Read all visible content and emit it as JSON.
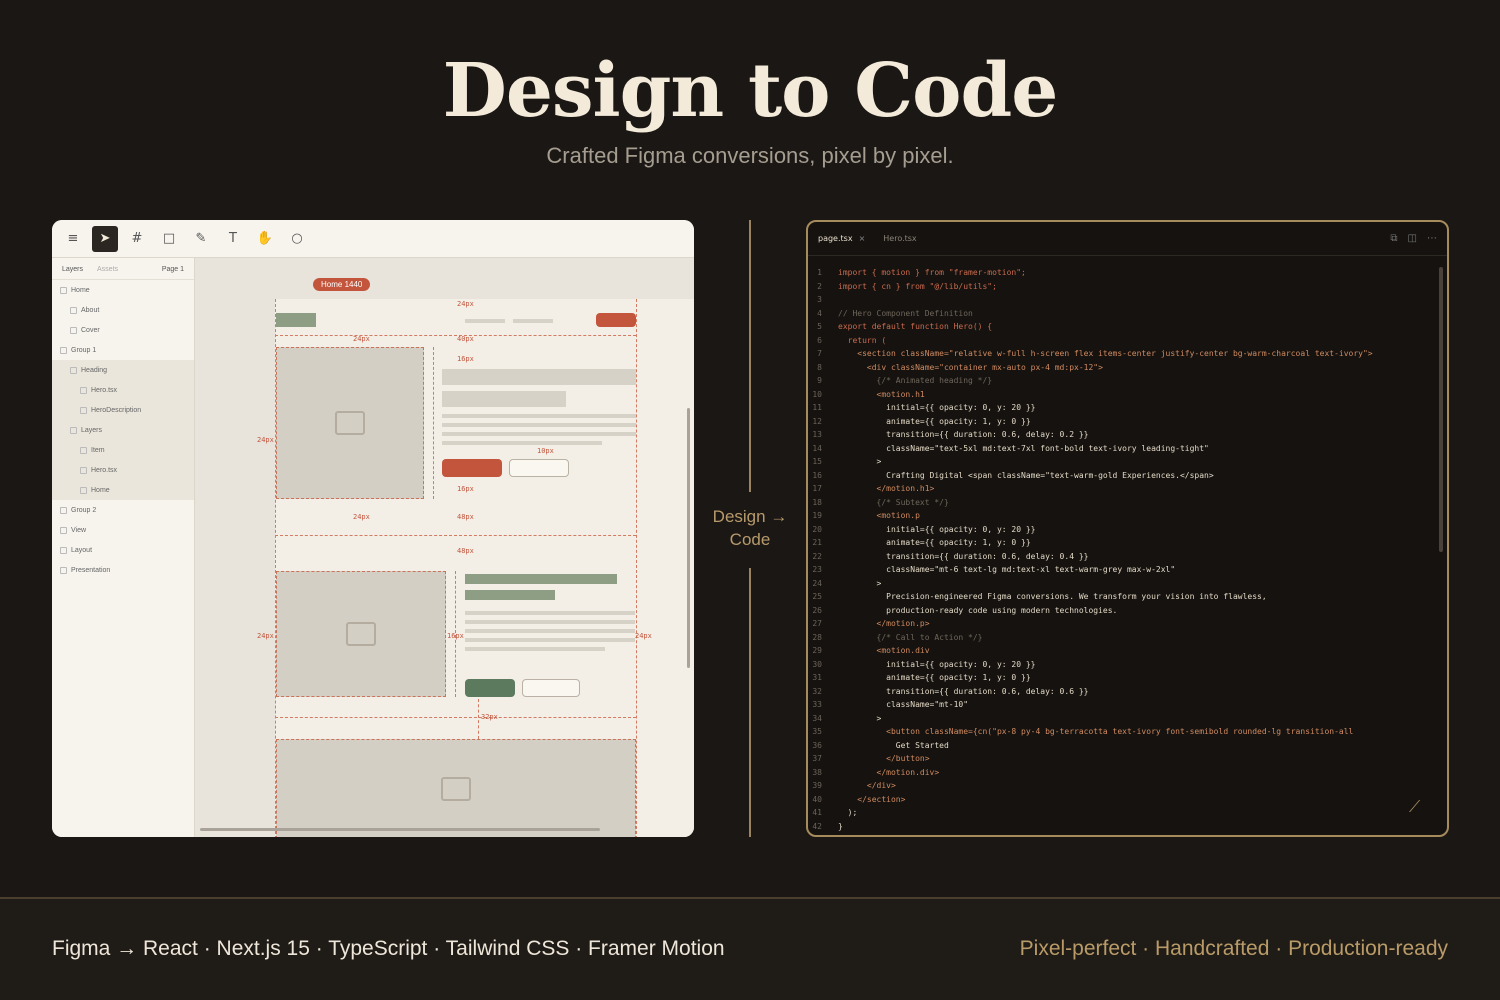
{
  "hero": {
    "title": "Design to Code",
    "subtitle": "Crafted Figma conversions, pixel by pixel."
  },
  "figma": {
    "sidebar_tabs": {
      "layers": "Layers",
      "assets": "Assets",
      "page": "Page 1"
    },
    "layers": [
      "Home",
      "About",
      "Cover",
      "Group 1",
      "Heading",
      "Hero.tsx",
      "HeroDescription",
      "Layers",
      "Item",
      "Hero.tsx",
      "Home",
      "Group 2",
      "View",
      "Layout",
      "Presentation"
    ],
    "frame_tag": "Home 1440",
    "specs": [
      "24px",
      "24px",
      "40px",
      "16px",
      "24px",
      "10px",
      "16px",
      "24px",
      "48px",
      "48px",
      "24px",
      "16px",
      "24px",
      "32px"
    ]
  },
  "middle": {
    "label": "Design → Code"
  },
  "editor": {
    "tabs": [
      {
        "label": "page.tsx",
        "active": true
      },
      {
        "label": "Hero.tsx",
        "active": false
      }
    ],
    "lines": [
      "import { motion } from \"framer-motion\";",
      "import { cn } from \"@/lib/utils\";",
      "",
      "// Hero Component Definition",
      "export default function Hero() {",
      "  return (",
      "    <section className=\"relative w-full h-screen flex items-center justify-center bg-warm-charcoal text-ivory\">",
      "      <div className=\"container mx-auto px-4 md:px-12\">",
      "        {/* Animated heading */}",
      "        <motion.h1",
      "          initial={{ opacity: 0, y: 20 }}",
      "          animate={{ opacity: 1, y: 0 }}",
      "          transition={{ duration: 0.6, delay: 0.2 }}",
      "          className=\"text-5xl md:text-7xl font-bold text-ivory leading-tight\"",
      "        >",
      "          Crafting Digital <span className=\"text-warm-gold Experiences.</span>",
      "        </motion.h1>",
      "        {/* Subtext */}",
      "        <motion.p",
      "          initial={{ opacity: 0, y: 20 }}",
      "          animate={{ opacity: 1, y: 0 }}",
      "          transition={{ duration: 0.6, delay: 0.4 }}",
      "          className=\"mt-6 text-lg md:text-xl text-warm-grey max-w-2xl\"",
      "        >",
      "          Precision-engineered Figma conversions. We transform your vision into flawless,",
      "          production-ready code using modern technologies.",
      "        </motion.p>",
      "        {/* Call to Action */}",
      "        <motion.div",
      "          initial={{ opacity: 0, y: 20 }}",
      "          animate={{ opacity: 1, y: 0 }}",
      "          transition={{ duration: 0.6, delay: 0.6 }}",
      "          className=\"mt-10\"",
      "        >",
      "          <button className={cn(\"px-8 py-4 bg-terracotta text-ivory font-semibold rounded-lg transition-all",
      "            Get Started",
      "          </button>",
      "        </motion.div>",
      "      </div>",
      "    </section>",
      "  );",
      "}"
    ]
  },
  "footer": {
    "left": "Figma → React · Next.js 15 · TypeScript · Tailwind CSS · Framer Motion",
    "right": "Pixel-perfect · Handcrafted · Production-ready"
  },
  "colors": {
    "background": "#1b1714",
    "accent_gold": "#b99b68",
    "terracotta": "#c2553c",
    "sage": "#5c7a5e"
  }
}
